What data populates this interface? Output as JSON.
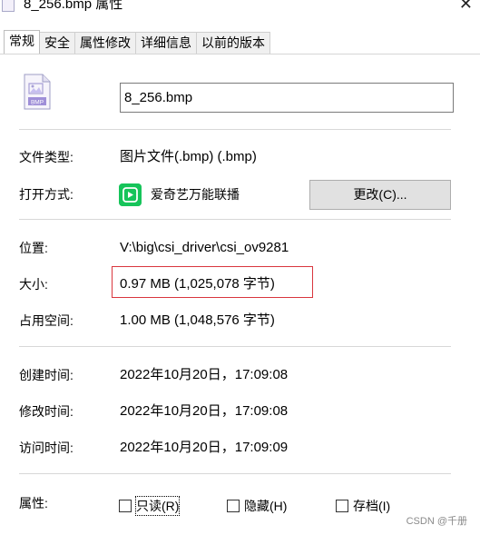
{
  "window": {
    "title": "8_256.bmp 属性",
    "close_glyph": "✕"
  },
  "tabs": [
    {
      "label": "常规",
      "active": true
    },
    {
      "label": "安全"
    },
    {
      "label": "属性修改"
    },
    {
      "label": "详细信息"
    },
    {
      "label": "以前的版本"
    }
  ],
  "general": {
    "file_icon": "bmp-file-icon",
    "file_icon_text": "BMP",
    "file_name": "8_256.bmp",
    "file_type_label": "文件类型:",
    "file_type_value": "图片文件(.bmp) (.bmp)",
    "opens_with_label": "打开方式:",
    "opens_with_app": "爱奇艺万能联播",
    "change_button": "更改(C)...",
    "location_label": "位置:",
    "location_value": "V:\\big\\csi_driver\\csi_ov9281",
    "size_label": "大小:",
    "size_value": "0.97 MB (1,025,078 字节)",
    "disk_size_label": "占用空间:",
    "disk_size_value": "1.00 MB (1,048,576 字节)",
    "created_label": "创建时间:",
    "created_value": "2022年10月20日，17:09:08",
    "modified_label": "修改时间:",
    "modified_value": "2022年10月20日，17:09:08",
    "accessed_label": "访问时间:",
    "accessed_value": "2022年10月20日，17:09:09",
    "attributes_label": "属性:",
    "attributes": [
      {
        "label": "只读(R)",
        "checked": false
      },
      {
        "label": "隐藏(H)",
        "checked": false
      },
      {
        "label": "存档(I)",
        "checked": false
      }
    ]
  },
  "colors": {
    "highlight_border": "#d9363e",
    "app_icon_green": "#16c45a",
    "button_bg": "#e1e1e1"
  },
  "watermark": "CSDN @千册"
}
